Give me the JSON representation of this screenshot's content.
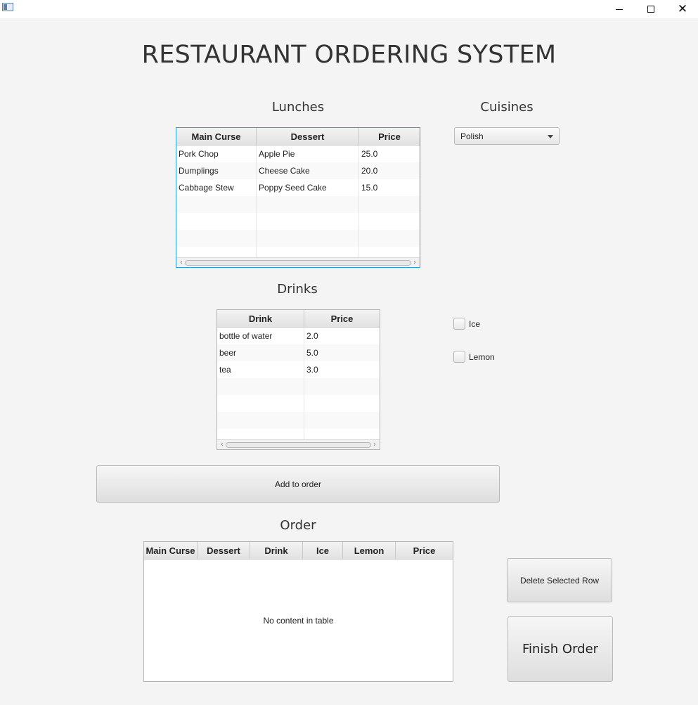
{
  "window": {
    "min_icon": "—",
    "close_icon": "✕"
  },
  "title": "RESTAURANT ORDERING SYSTEM",
  "lunches": {
    "heading": "Lunches",
    "columns": [
      "Main Curse",
      "Dessert",
      "Price"
    ],
    "rows": [
      [
        "Pork Chop",
        "Apple Pie",
        "25.0"
      ],
      [
        "Dumplings",
        "Cheese Cake",
        "20.0"
      ],
      [
        "Cabbage Stew",
        "Poppy Seed Cake",
        "15.0"
      ]
    ]
  },
  "cuisines": {
    "heading": "Cuisines",
    "selected": "Polish"
  },
  "drinks": {
    "heading": "Drinks",
    "columns": [
      "Drink",
      "Price"
    ],
    "rows": [
      [
        "bottle of water",
        "2.0"
      ],
      [
        "beer",
        "5.0"
      ],
      [
        "tea",
        "3.0"
      ]
    ]
  },
  "options": {
    "ice_label": "Ice",
    "ice_checked": false,
    "lemon_label": "Lemon",
    "lemon_checked": false
  },
  "add_button": "Add to order",
  "order": {
    "heading": "Order",
    "columns": [
      "Main Curse",
      "Dessert",
      "Drink",
      "Ice",
      "Lemon",
      "Price"
    ],
    "empty_text": "No content in table"
  },
  "delete_button": "Delete Selected Row",
  "finish_button": "Finish Order",
  "icons": {
    "scroll_left": "‹",
    "scroll_right": "›"
  },
  "colors": {
    "focus_border": "#2a9fd6",
    "background": "#f4f4f4"
  }
}
